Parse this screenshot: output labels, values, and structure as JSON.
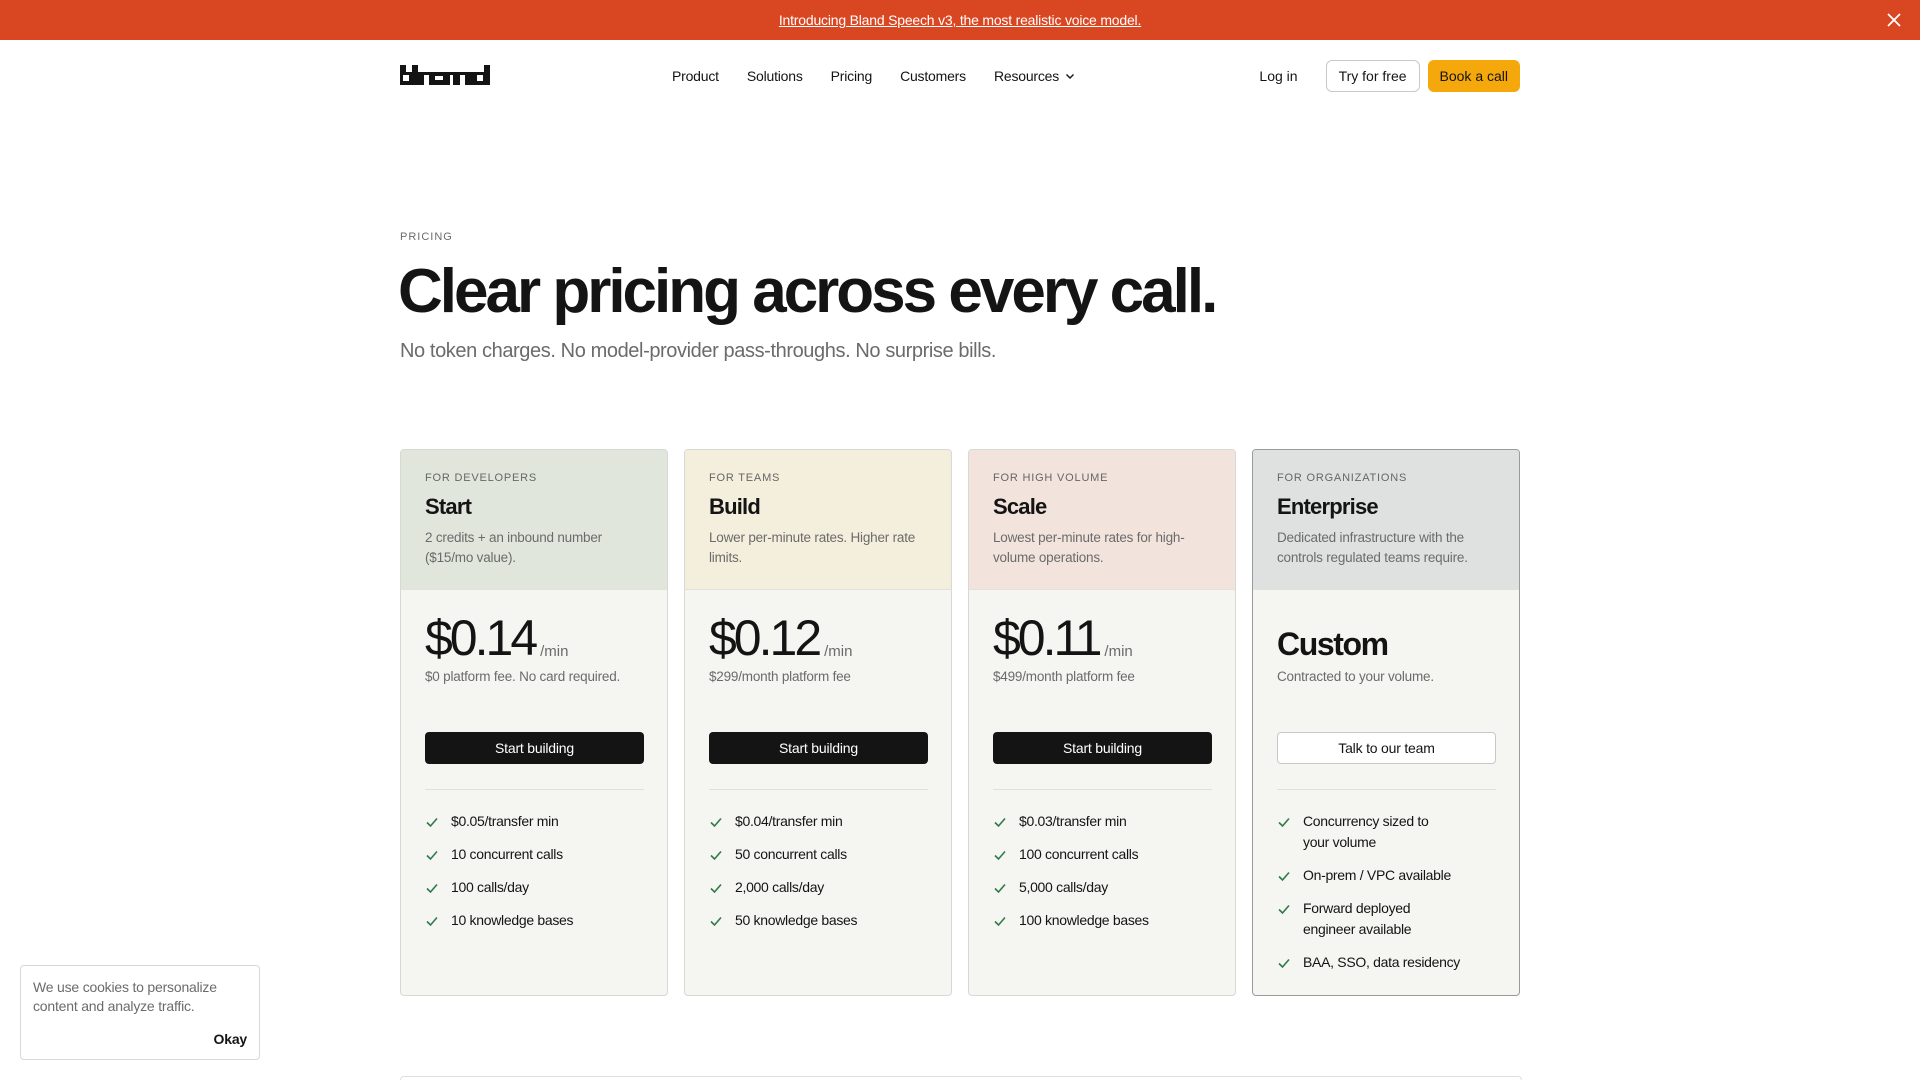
{
  "announcement": {
    "text": "Introducing Bland Speech v3, the most realistic voice model."
  },
  "nav": {
    "links": [
      "Product",
      "Solutions",
      "Pricing",
      "Customers",
      "Resources"
    ],
    "login": "Log in",
    "try_free": "Try for free",
    "book_call": "Book a call"
  },
  "hero": {
    "eyebrow": "PRICING",
    "title": "Clear pricing across every call.",
    "subtitle": "No token charges. No model-provider pass-throughs. No surprise bills."
  },
  "plans": [
    {
      "tag": "FOR DEVELOPERS",
      "name": "Start",
      "description": "2 credits + an inbound number ($15/mo value).",
      "price": "$0.14",
      "per": "/min",
      "fee": "$0 platform fee. No card required.",
      "cta": "Start building",
      "features": [
        "$0.05/transfer min",
        "10 concurrent calls",
        "100 calls/day",
        "10 knowledge bases"
      ]
    },
    {
      "tag": "FOR TEAMS",
      "name": "Build",
      "description": "Lower per-minute rates. Higher rate limits.",
      "price": "$0.12",
      "per": "/min",
      "fee": "$299/month platform fee",
      "cta": "Start building",
      "features": [
        "$0.04/transfer min",
        "50 concurrent calls",
        "2,000 calls/day",
        "50 knowledge bases"
      ]
    },
    {
      "tag": "FOR HIGH VOLUME",
      "name": "Scale",
      "description": "Lowest per-minute rates for high-volume operations.",
      "price": "$0.11",
      "per": "/min",
      "fee": "$499/month platform fee",
      "cta": "Start building",
      "features": [
        "$0.03/transfer min",
        "100 concurrent calls",
        "5,000 calls/day",
        "100 knowledge bases"
      ]
    },
    {
      "tag": "FOR ORGANIZATIONS",
      "name": "Enterprise",
      "description": "Dedicated infrastructure with the controls regulated teams require.",
      "price": "Custom",
      "fee": "Contracted to your volume.",
      "cta": "Talk to our team",
      "features": [
        "Concurrency sized to your volume",
        "On-prem / VPC available",
        "Forward deployed engineer available",
        "BAA, SSO, data residency"
      ]
    }
  ],
  "cookie": {
    "text": "We use cookies to personalize content and analyze traffic.",
    "ok": "Okay"
  },
  "colors": {
    "announcement_bg": "#d94722",
    "accent_button": "#f5a80b",
    "check": "#2f7a4a"
  }
}
